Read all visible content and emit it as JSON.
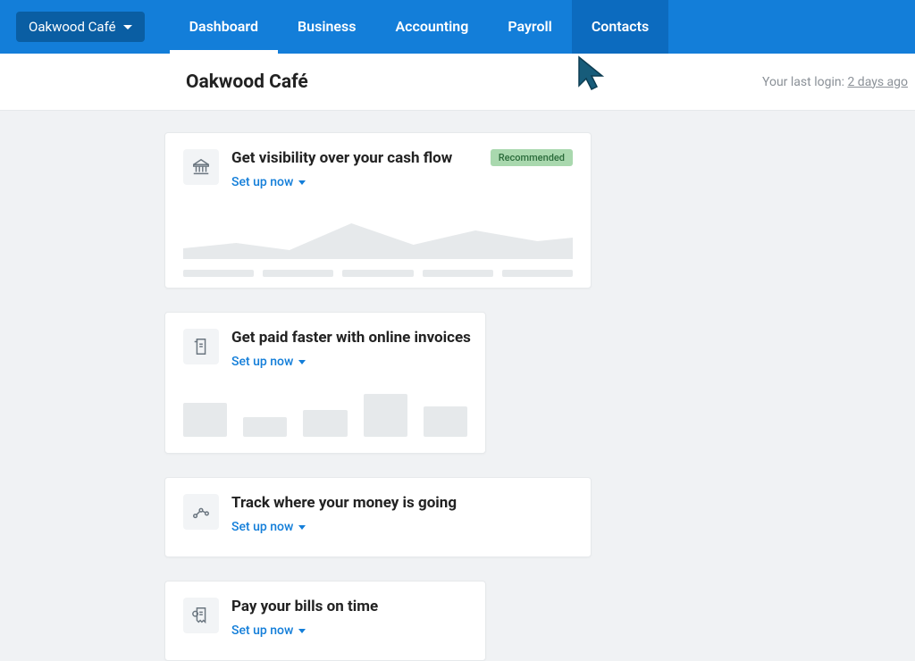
{
  "nav": {
    "company": "Oakwood Café",
    "items": [
      "Dashboard",
      "Business",
      "Accounting",
      "Payroll",
      "Contacts"
    ],
    "active": "Dashboard",
    "hover": "Contacts"
  },
  "header": {
    "title": "Oakwood Café",
    "last_login_prefix": "Your last login: ",
    "last_login_value": "2 days ago"
  },
  "cards": [
    {
      "title": "Get visibility over your cash flow",
      "link": "Set up now",
      "badge": "Recommended"
    },
    {
      "title": "Get paid faster with online invoices",
      "link": "Set up now"
    },
    {
      "title": "Track where your money is going",
      "link": "Set up now"
    },
    {
      "title": "Pay your bills on time",
      "link": "Set up now"
    }
  ]
}
